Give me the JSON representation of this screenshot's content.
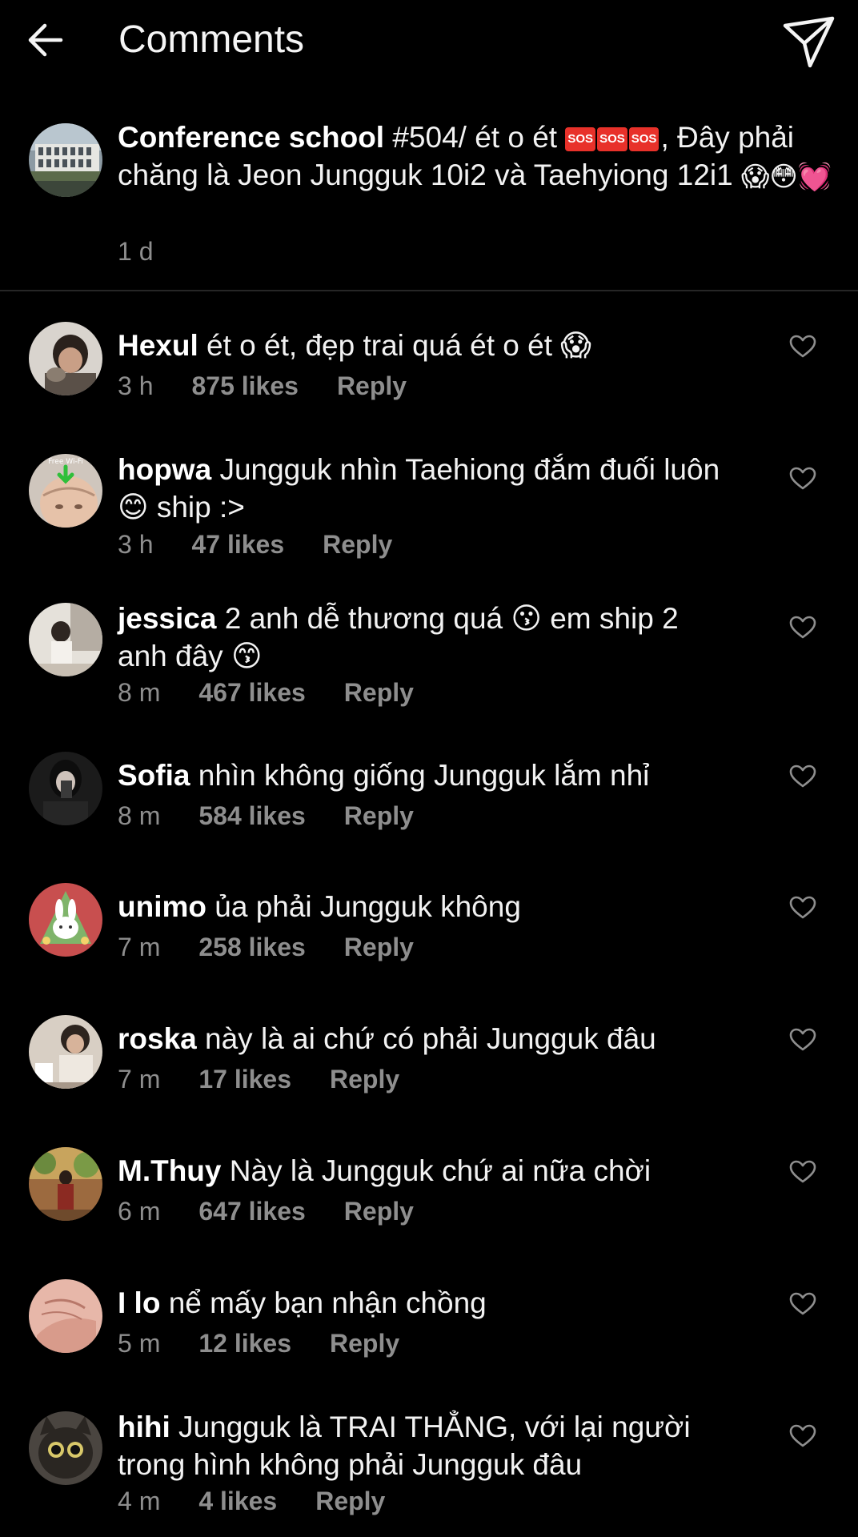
{
  "header": {
    "title": "Comments"
  },
  "caption": {
    "username": "Conference school",
    "text_a": "#504/ ét o ét ",
    "sos": [
      "SOS",
      "SOS",
      "SOS"
    ],
    "text_b": ", Đây phải chăng là Jeon Jungguk 10i2 và Taehyiong 12i1 ",
    "emojis": "😱😳💓",
    "time": "1 d"
  },
  "comments": [
    {
      "username": "Hexul",
      "text": "ét o ét, đẹp trai quá ét o ét 😱",
      "time": "3 h",
      "likes": "875 likes",
      "reply": "Reply"
    },
    {
      "username": "hopwa",
      "text": "Jungguk nhìn Taehiong đắm đuối luôn 😊 ship :>",
      "time": "3 h",
      "likes": "47 likes",
      "reply": "Reply"
    },
    {
      "username": "jessica",
      "text": "2 anh dễ thương quá 😗 em ship 2 anh đây 😙",
      "time": "8 m",
      "likes": "467 likes",
      "reply": "Reply"
    },
    {
      "username": "Sofia",
      "text": "nhìn không giống Jungguk lắm nhỉ",
      "time": "8 m",
      "likes": "584 likes",
      "reply": "Reply"
    },
    {
      "username": "unimo",
      "text": "ủa phải Jungguk không",
      "time": "7 m",
      "likes": "258 likes",
      "reply": "Reply"
    },
    {
      "username": "roska",
      "text": "này là ai chứ có phải Jungguk đâu",
      "time": "7 m",
      "likes": "17 likes",
      "reply": "Reply"
    },
    {
      "username": "M.Thuy",
      "text": "Này là Jungguk chứ ai nữa chời",
      "time": "6 m",
      "likes": "647 likes",
      "reply": "Reply"
    },
    {
      "username": "I lo",
      "text": "nể mấy bạn nhận chồng",
      "time": "5 m",
      "likes": "12 likes",
      "reply": "Reply"
    },
    {
      "username": "hihi",
      "text": "Jungguk là TRAI THẲNG, với lại người trong hình không phải Jungguk đâu",
      "time": "4 m",
      "likes": "4 likes",
      "reply": "Reply"
    }
  ],
  "avatar_badge": "Free Wi-Fi",
  "colors": {
    "background": "#000000",
    "text": "#f2f2f2",
    "meta": "#8e8e8e",
    "divider": "#262626"
  },
  "icons": {
    "back": "arrow-left-icon",
    "send": "paper-plane-icon",
    "like": "heart-outline-icon"
  }
}
